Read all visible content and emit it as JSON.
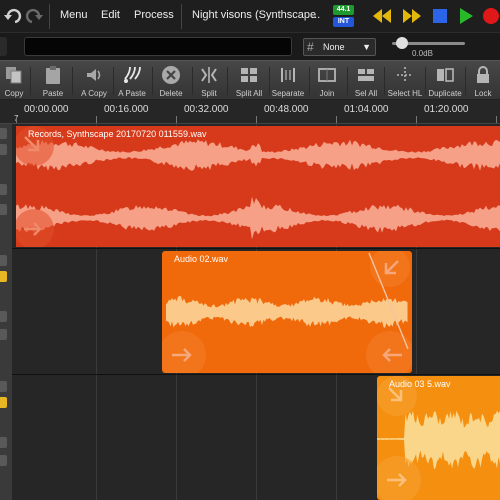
{
  "menubar": {
    "menu_label": "Menu",
    "edit_label": "Edit",
    "process_label": "Process",
    "project_title": "Night visons (Synthscape",
    "ellipsis": "...",
    "sample_rate_badge": "44.1",
    "clock_badge": "INT",
    "badge_colors": {
      "sample_rate": "#1f9a2f",
      "clock": "#2356d8"
    }
  },
  "subbar": {
    "snap_value": "None",
    "volume_label": "0.0dB"
  },
  "toolbar": {
    "copy": "Copy",
    "paste": "Paste",
    "a_copy": "A Copy",
    "a_paste": "A Paste",
    "delete": "Delete",
    "split": "Split",
    "split_all": "Split All",
    "separate": "Separate",
    "join": "Join",
    "sel_all": "Sel All",
    "select_hl": "Select HL",
    "duplicate": "Duplicate",
    "lock": "Lock"
  },
  "ruler": {
    "t0": "00:00.000",
    "t1": "00:16.000",
    "t2": "00:32.000",
    "t3": "00:48.000",
    "t4": "01:04.000",
    "t5": "01:20.000",
    "marker": "7"
  },
  "clips": {
    "clip1": "Records, Synthscape 20170720 011559.wav",
    "clip2": "Audio 02.wav",
    "clip3": "Audio 03 5.wav"
  },
  "colors": {
    "clip1": "#d63a1a",
    "clip2": "#f06a0c",
    "clip3": "#f58f10",
    "waveform1": "#f7a088",
    "waveform2": "#fbc98a",
    "waveform3": "#f9d68a",
    "transport": "#e3b80c",
    "stop": "#2b64e6",
    "play": "#28b828",
    "record": "#e01818"
  }
}
